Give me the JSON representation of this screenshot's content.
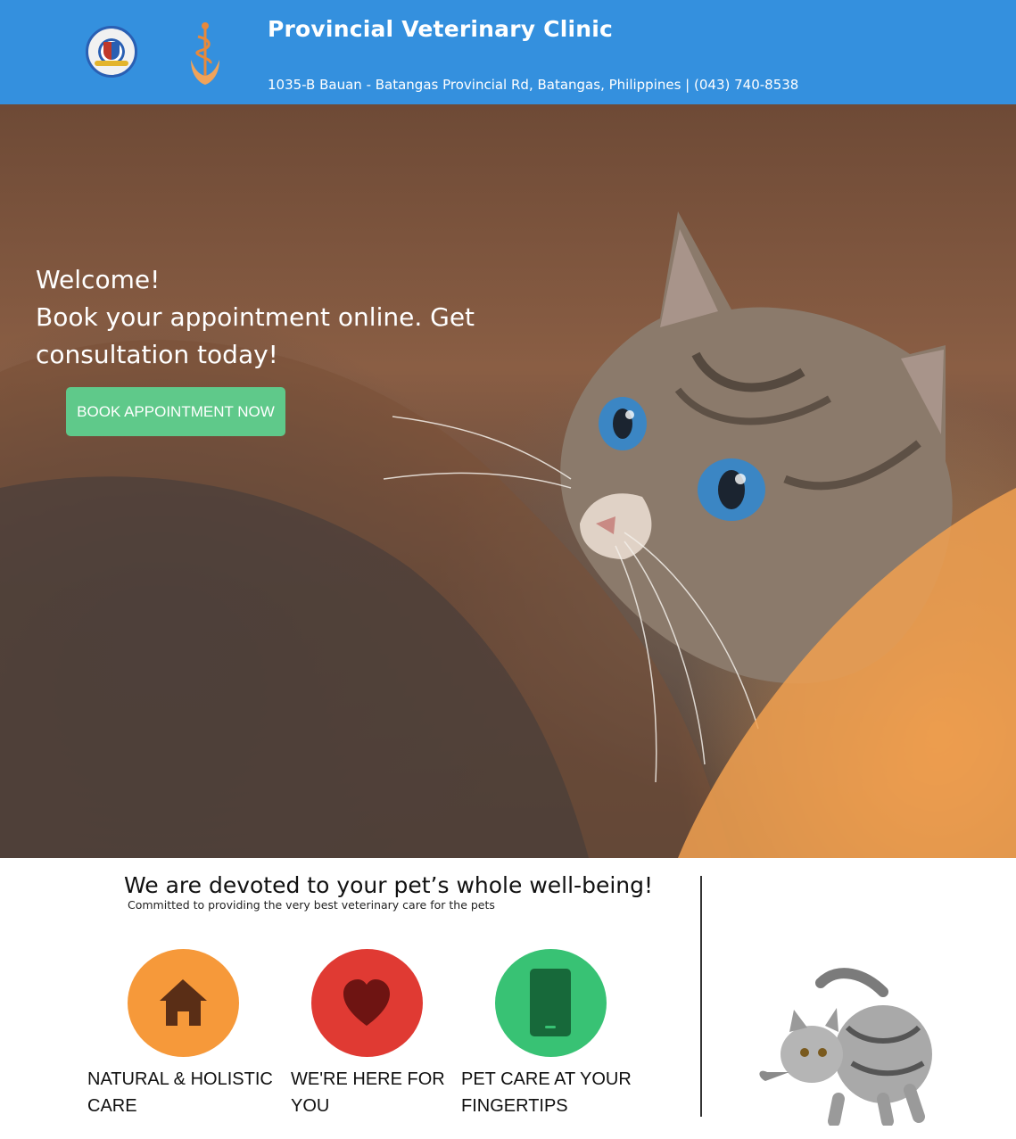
{
  "header": {
    "title": "Provincial Veterinary Clinic",
    "address": "1035-B Bauan - Batangas Provincial Rd, Batangas, Philippines | (043) 740-8538",
    "seal_icon": "provincial-seal-icon",
    "logo_icon": "veterinary-caduceus-icon",
    "background_color": "#3490de"
  },
  "hero": {
    "line1": "Welcome!",
    "line2": "Book your appointment online. Get consultation today!",
    "button_label": "BOOK APPOINTMENT NOW",
    "button_color": "#5fc98a"
  },
  "section": {
    "title": "We are devoted to your pet’s whole well-being!",
    "subtitle": "Committed to providing the very best veterinary care for the pets"
  },
  "features": [
    {
      "label": "NATURAL & HOLISTIC CARE",
      "icon": "home-icon",
      "color": "#f6993a"
    },
    {
      "label": "WE'RE HERE FOR YOU",
      "icon": "heart-icon",
      "color": "#e03a33"
    },
    {
      "label": "PET CARE AT YOUR FINGERTIPS",
      "icon": "smartphone-icon",
      "color": "#38c274"
    }
  ]
}
